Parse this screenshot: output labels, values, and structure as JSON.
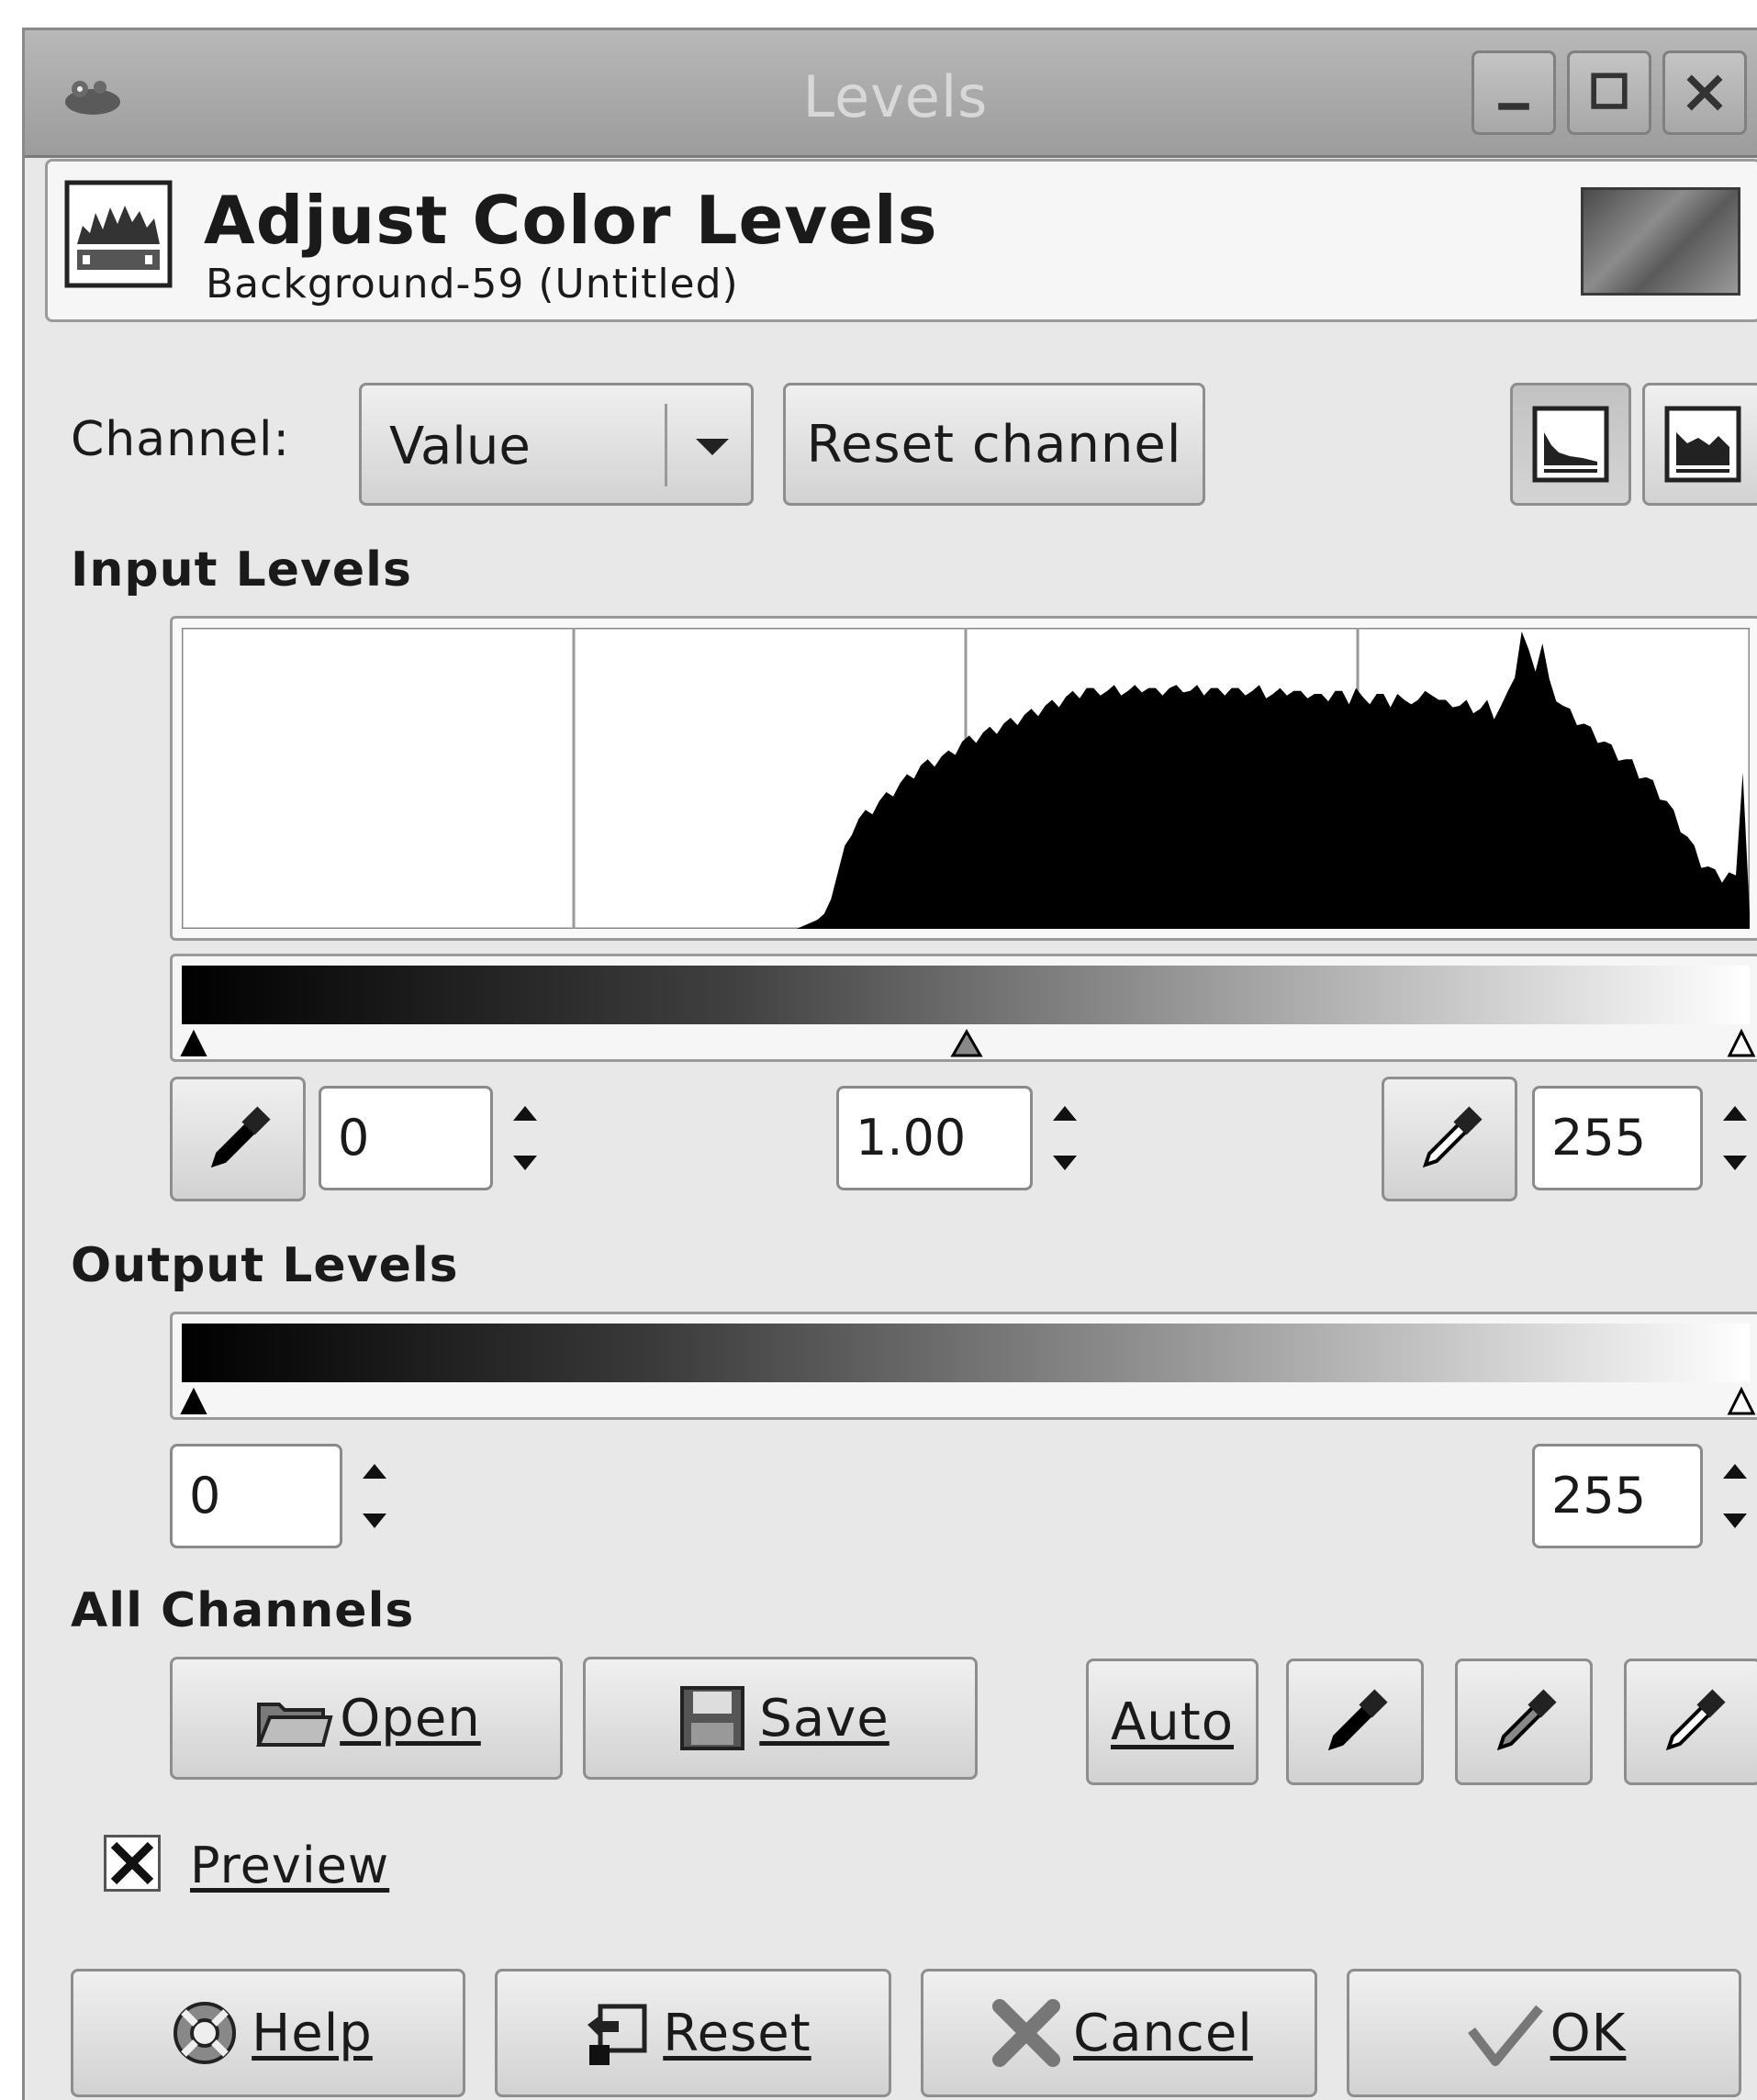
{
  "window": {
    "title": "Levels"
  },
  "header": {
    "title": "Adjust Color Levels",
    "subtitle": "Background-59 (Untitled)"
  },
  "channel": {
    "label": "Channel:",
    "value": "Value",
    "reset_label": "Reset channel"
  },
  "input_levels": {
    "heading": "Input Levels",
    "low": "0",
    "gamma": "1.00",
    "high": "255"
  },
  "output_levels": {
    "heading": "Output Levels",
    "low": "0",
    "high": "255"
  },
  "all_channels": {
    "heading": "All Channels",
    "open_label": "Open",
    "save_label": "Save",
    "auto_label": "Auto"
  },
  "preview": {
    "label": "Preview",
    "checked": true
  },
  "footer": {
    "help_label": "Help",
    "reset_label": "Reset",
    "cancel_label": "Cancel",
    "ok_label": "OK"
  },
  "histogram": {
    "min_value": 0,
    "max_value": 255,
    "gridlines": 4,
    "shape": [
      0,
      0,
      0,
      0,
      0,
      0,
      0,
      0,
      0,
      0,
      0,
      0,
      0,
      0,
      0,
      0,
      0,
      0,
      0,
      0,
      0,
      0,
      0,
      0,
      0,
      0,
      0,
      0,
      0,
      0,
      0,
      0,
      0,
      0,
      0,
      0,
      0,
      0,
      0,
      0,
      0,
      0,
      0,
      0,
      0,
      0,
      0,
      0,
      0,
      0,
      0,
      0,
      0,
      0,
      0,
      0,
      0,
      0,
      0,
      0,
      0,
      0,
      0,
      0,
      0,
      0,
      0,
      0,
      0,
      0,
      0,
      0,
      0,
      0,
      0,
      0,
      0,
      0,
      0,
      0,
      0,
      0,
      0,
      0,
      0,
      0,
      0,
      0,
      0,
      0,
      0.01,
      0.02,
      0.03,
      0.05,
      0.1,
      0.18,
      0.26,
      0.33,
      0.36,
      0.38,
      0.4,
      0.42,
      0.44,
      0.46,
      0.48,
      0.5,
      0.52,
      0.54,
      0.55,
      0.56,
      0.57,
      0.58,
      0.6,
      0.62,
      0.63,
      0.64,
      0.65,
      0.66,
      0.67,
      0.68,
      0.69,
      0.7,
      0.71,
      0.72,
      0.73,
      0.74,
      0.75,
      0.76,
      0.77,
      0.78,
      0.79,
      0.8,
      0.79,
      0.8,
      0.79,
      0.8,
      0.8,
      0.79,
      0.8,
      0.81,
      0.8,
      0.79,
      0.8,
      0.8,
      0.8,
      0.81,
      0.79,
      0.8,
      0.8,
      0.8,
      0.79,
      0.8,
      0.8,
      0.79,
      0.8,
      0.79,
      0.8,
      0.79,
      0.78,
      0.79,
      0.8,
      0.79,
      0.78,
      0.79,
      0.78,
      0.77,
      0.78,
      0.79,
      0.78,
      0.77,
      0.8,
      0.76,
      0.77,
      0.78,
      0.77,
      0.76,
      0.78,
      0.75,
      0.77,
      0.76,
      0.78,
      0.8,
      0.76,
      0.75,
      0.76,
      0.74,
      0.75,
      0.74,
      0.73,
      0.75,
      0.72,
      0.74,
      0.78,
      0.86,
      1.0,
      0.92,
      0.88,
      0.95,
      0.82,
      0.78,
      0.74,
      0.72,
      0.7,
      0.68,
      0.66,
      0.64,
      0.62,
      0.6,
      0.58,
      0.56,
      0.55,
      0.52,
      0.5,
      0.48,
      0.45,
      0.42,
      0.38,
      0.34,
      0.3,
      0.26,
      0.22,
      0.2,
      0.18,
      0.17,
      0.18,
      0.16,
      0.54,
      0.05
    ]
  }
}
